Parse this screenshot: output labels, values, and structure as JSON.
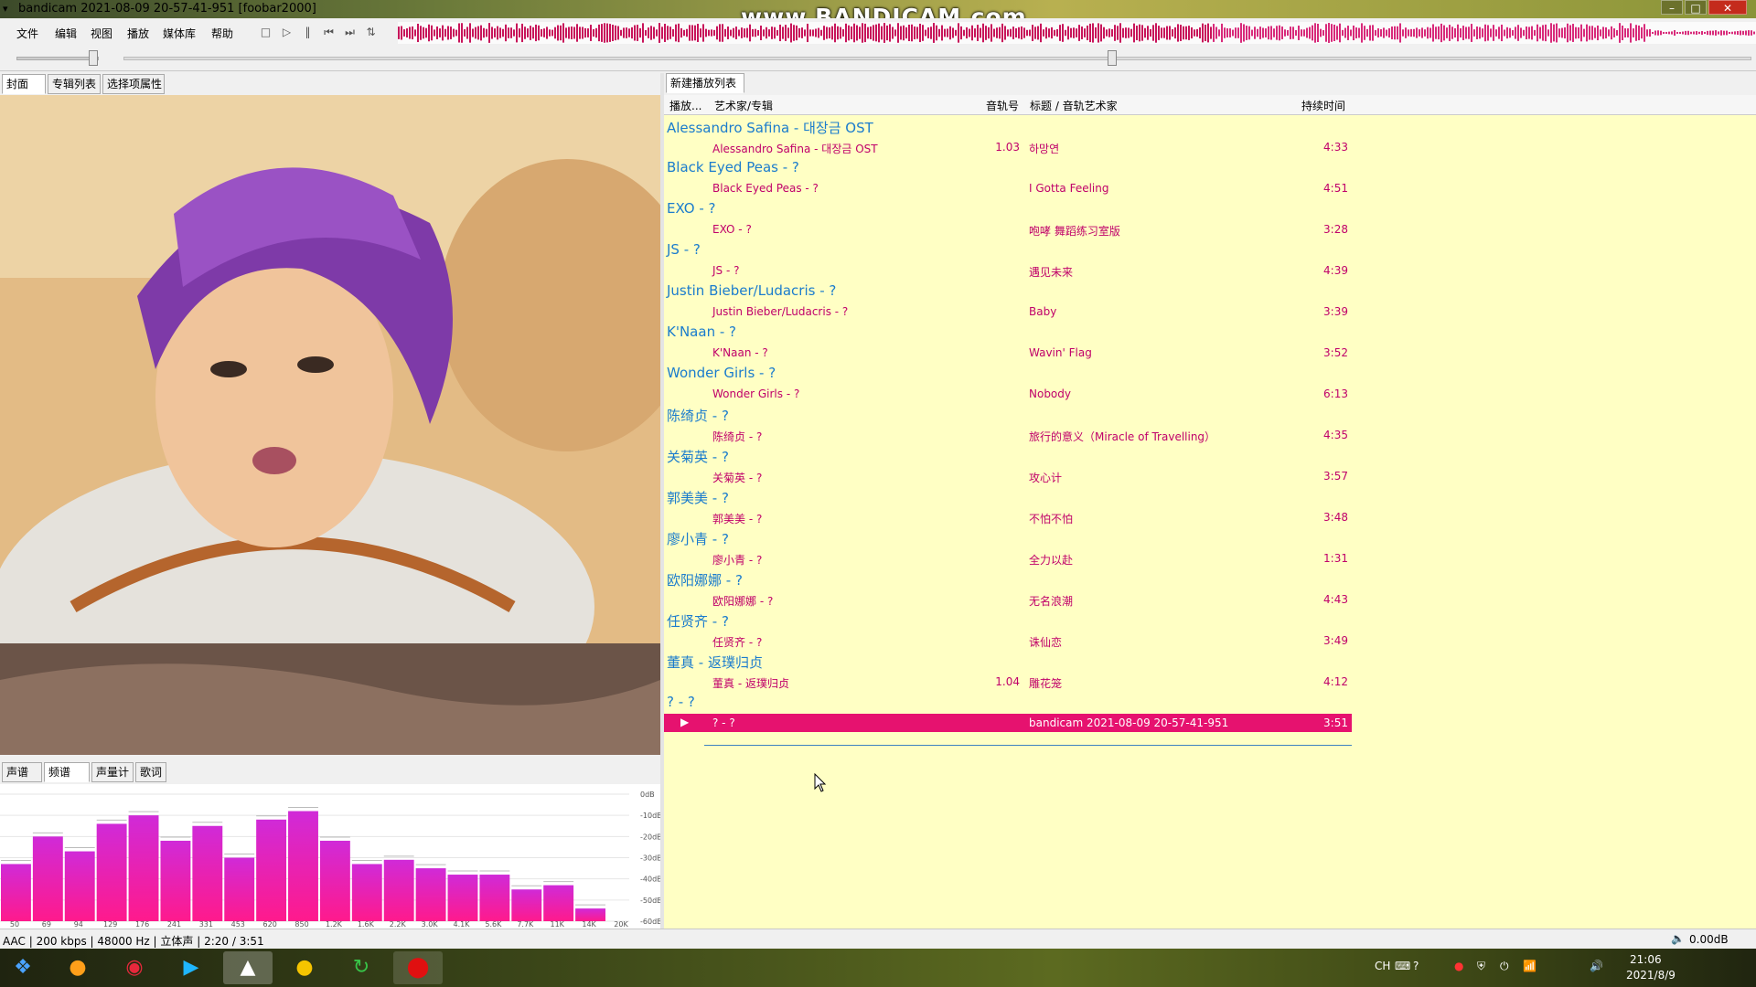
{
  "window": {
    "title": "bandicam 2021-08-09 20-57-41-951  [foobar2000]",
    "watermark": "www.BANDICAM.com"
  },
  "menu": [
    "文件",
    "编辑",
    "视图",
    "播放",
    "媒体库",
    "帮助"
  ],
  "left_tabs": [
    "封面",
    "专辑列表",
    "选择项属性"
  ],
  "bottom_tabs": [
    "声谱",
    "频谱",
    "声量计",
    "歌词"
  ],
  "playlist_tab": "新建播放列表",
  "columns": {
    "playing": "播放...",
    "artist_album": "艺术家/专辑",
    "track_no": "音轨号",
    "title_artist": "标题 / 音轨艺术家",
    "duration": "持续时间"
  },
  "groups": [
    {
      "header": "Alessandro Safina - 대장금 OST",
      "track": {
        "artist_album": "Alessandro Safina - 대장금 OST",
        "track_no": "1.03",
        "title": "하망연",
        "duration": "4:33"
      }
    },
    {
      "header": "Black Eyed Peas - ?",
      "track": {
        "artist_album": "Black Eyed Peas - ?",
        "track_no": "",
        "title": "I Gotta Feeling",
        "duration": "4:51"
      }
    },
    {
      "header": "EXO - ?",
      "track": {
        "artist_album": "EXO - ?",
        "track_no": "",
        "title": "咆哮 舞蹈练习室版",
        "duration": "3:28"
      }
    },
    {
      "header": "JS - ?",
      "track": {
        "artist_album": "JS - ?",
        "track_no": "",
        "title": "遇见未来",
        "duration": "4:39"
      }
    },
    {
      "header": "Justin Bieber/Ludacris - ?",
      "track": {
        "artist_album": "Justin Bieber/Ludacris - ?",
        "track_no": "",
        "title": "Baby",
        "duration": "3:39"
      }
    },
    {
      "header": "K'Naan - ?",
      "track": {
        "artist_album": "K'Naan - ?",
        "track_no": "",
        "title": "Wavin' Flag",
        "duration": "3:52"
      }
    },
    {
      "header": "Wonder Girls - ?",
      "track": {
        "artist_album": "Wonder Girls - ?",
        "track_no": "",
        "title": "Nobody",
        "duration": "6:13"
      }
    },
    {
      "header": "陈绮贞 - ?",
      "track": {
        "artist_album": "陈绮贞 - ?",
        "track_no": "",
        "title": "旅行的意义（Miracle of Travelling）",
        "duration": "4:35"
      }
    },
    {
      "header": "关菊英 - ?",
      "track": {
        "artist_album": "关菊英 - ?",
        "track_no": "",
        "title": "攻心计",
        "duration": "3:57"
      }
    },
    {
      "header": "郭美美 - ?",
      "track": {
        "artist_album": "郭美美 - ?",
        "track_no": "",
        "title": "不怕不怕",
        "duration": "3:48"
      }
    },
    {
      "header": "廖小青 - ?",
      "track": {
        "artist_album": "廖小青 - ?",
        "track_no": "",
        "title": "全力以赴",
        "duration": "1:31"
      }
    },
    {
      "header": "欧阳娜娜 - ?",
      "track": {
        "artist_album": "欧阳娜娜 - ?",
        "track_no": "",
        "title": "无名浪潮",
        "duration": "4:43"
      }
    },
    {
      "header": "任贤齐 - ?",
      "track": {
        "artist_album": "任贤齐 - ?",
        "track_no": "",
        "title": "诛仙恋",
        "duration": "3:49"
      }
    },
    {
      "header": "董真 - 返璞归贞",
      "track": {
        "artist_album": "董真 - 返璞归贞",
        "track_no": "1.04",
        "title": "雕花笼",
        "duration": "4:12"
      }
    },
    {
      "header": "? - ?",
      "track": {
        "artist_album": "? - ?",
        "track_no": "",
        "title": "bandicam 2021-08-09 20-57-41-951",
        "duration": "3:51",
        "playing": true
      }
    }
  ],
  "spectrum": {
    "db_labels": [
      "0dB",
      "-10dB",
      "-20dB",
      "-30dB",
      "-40dB",
      "-50dB",
      "-60dB"
    ],
    "freq_labels": [
      "50",
      "69",
      "94",
      "129",
      "176",
      "241",
      "331",
      "453",
      "620",
      "850",
      "1.2K",
      "1.6K",
      "2.2K",
      "3.0K",
      "4.1K",
      "5.6K",
      "7.7K",
      "11K",
      "14K",
      "20K"
    ],
    "bar_db": [
      -33,
      -20,
      -27,
      -14,
      -10,
      -22,
      -15,
      -30,
      -12,
      -8,
      -22,
      -33,
      -31,
      -35,
      -38,
      -38,
      -45,
      -43,
      -54
    ],
    "bar_color_top": "#d02ad8",
    "bar_color_bottom": "#ff1a8c"
  },
  "status": {
    "info": "AAC | 200 kbps | 48000 Hz | 立体声 | 2:20 / 3:51",
    "volume": "0.00dB"
  },
  "taskbar": {
    "apps": [
      "windows-start-icon",
      "sogou-icon",
      "netease-music-icon",
      "youku-icon",
      "foobar-alien-icon",
      "game-ball-icon",
      "green-refresh-icon",
      "bandicam-record-icon"
    ],
    "tray_lang": "CH",
    "time": "21:06",
    "date": "2021/8/9"
  },
  "colors": {
    "playlist_bg": "#ffffc4",
    "group_header": "#1b7ccd",
    "track_text": "#c0006a",
    "selected_row": "#e6126f"
  },
  "playback": {
    "seek_fraction": 0.6
  }
}
